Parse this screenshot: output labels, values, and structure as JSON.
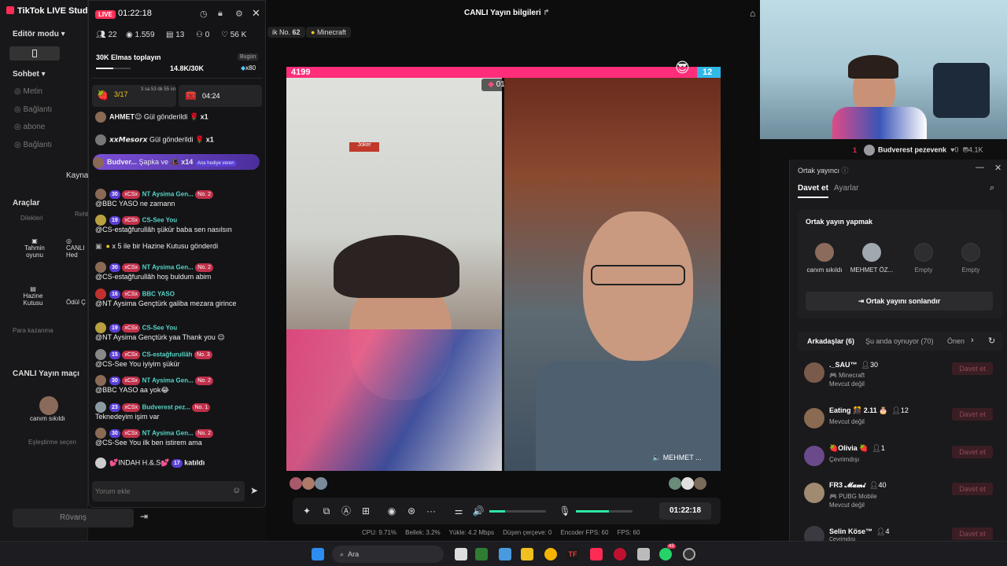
{
  "studio": {
    "title": "TikTok LIVE Studio",
    "editor_mode": "Editör modu",
    "chat_label": "Sohbet",
    "chat_items": [
      "Metin",
      "Bağlantı",
      "abone",
      "Bağlantı"
    ],
    "source": "Kaynak",
    "tools_label": "Araçlar",
    "tool_dilekler": "Dilekleri",
    "tool_rehber": "Rehb",
    "tool_tahmin": "Tahmin oyunu",
    "tool_canli": "CANLI Hed",
    "tool_hazine": "Hazine Kutusu",
    "tool_odul": "Ödül Ç",
    "money_label": "Para kazanma",
    "match_label": "CANLI Yayın maçı",
    "match_guest": "canım sıkıldı",
    "pairing": "Eşleştirme seçen",
    "rematch": "Rövanş"
  },
  "chat": {
    "live_badge": "LIVE",
    "timer": "01:22:18",
    "viewers": "22",
    "views": "1.559",
    "gifts": "13",
    "shares": "0",
    "likes": "56 K",
    "goal_title": "30K Elmas toplayın",
    "goal_tag": "Bugün",
    "goal_progress": "14.8K/30K",
    "goal_progress_pct": 49,
    "goal_mult": "x80",
    "box1_count": "3/17",
    "box1_time": "3 sa 53 dk 55 sn",
    "box2_time": "04:24",
    "gift1_user": "AHMET😉",
    "gift1_text": "Gül gönderildi",
    "gift1_count": "x1",
    "gift2_user": "𝙭𝙭𝙈𝙚𝙨𝙤𝙧𝙭",
    "gift2_text": "Gül gönderildi",
    "gift2_count": "x1",
    "gift3_user": "Budver...",
    "gift3_text": "Şapka ve",
    "gift3_count": "x14",
    "gift3_tag": "Ana hediye veren",
    "messages": [
      {
        "lvl": "30",
        "tag": "xCSx",
        "name": "NT Aysima Gen...",
        "rank": "No. 2",
        "text": "@BBC YASO ne zamann"
      },
      {
        "lvl": "19",
        "tag": "xCSx",
        "name": "CS-See You",
        "rank": "",
        "text": "@CS-estağfurullâh şükür baba sen nasılsın"
      },
      {
        "lvl": "",
        "tag": "",
        "name": "",
        "rank": "",
        "text": "x 5 ile bir Hazine Kutusu gönderdi"
      },
      {
        "lvl": "30",
        "tag": "xCSx",
        "name": "NT Aysima Gen...",
        "rank": "No. 2",
        "text": "@CS-estağfurullâh hoş buldum abim"
      },
      {
        "lvl": "16",
        "tag": "xCSx",
        "name": "BBC YASO",
        "rank": "",
        "text": "@NT Aysima Gençtürk galiba mezara girince"
      },
      {
        "lvl": "19",
        "tag": "xCSx",
        "name": "CS-See You",
        "rank": "",
        "text": "@NT Aysima Gençtürk yaa Thank you 😉"
      },
      {
        "lvl": "15",
        "tag": "xCSx",
        "name": "CS-estağfurullâh",
        "rank": "No. 3",
        "text": "@CS-See You iyiyim şükür"
      },
      {
        "lvl": "30",
        "tag": "xCSx",
        "name": "NT Aysima Gen...",
        "rank": "No. 2",
        "text": "@BBC YASO aa yok😂"
      },
      {
        "lvl": "23",
        "tag": "xCSx",
        "name": "Budverest pez...",
        "rank": "No. 1",
        "text": "Teknedeyim işim var"
      },
      {
        "lvl": "30",
        "tag": "xCSx",
        "name": "NT Aysima Gen...",
        "rank": "No. 2",
        "text": "@CS-See You ilk ben istirem ama"
      }
    ],
    "joined_user": "💕INDAH H.&.S💕",
    "joined_lvl": "17",
    "joined_text": "katıldı",
    "comment_placeholder": "Yorum ekle"
  },
  "center": {
    "title": "CANLI Yayın bilgileri",
    "rank_label": "ik No.",
    "rank_value": "62",
    "game": "Minecraft",
    "score_left": "4199",
    "score_right": "12",
    "battle_timer": "01:01",
    "right_name": "MEHMET ...",
    "time": "01:22:18"
  },
  "status": {
    "cpu": "CPU: 9.71%",
    "mem": "Bellek: 3.2%",
    "upload": "Yükle: 4.2 Mbps",
    "dropped": "Düşen çerçeve: 0",
    "encoder": "Encoder FPS: 60",
    "fps": "FPS: 60"
  },
  "cam": {
    "rank": "1",
    "user": "Budverest pezevenk",
    "hearts": "0",
    "coins": "4.1K"
  },
  "cohost": {
    "title": "Ortak yayıncı",
    "tab_invite": "Davet et",
    "tab_settings": "Ayarlar",
    "section": "Ortak yayın yapmak",
    "guests": [
      "canım sıkıldı",
      "MEHMET ÖZ...",
      "Empty",
      "Empty"
    ],
    "end_button": "Ortak yayını sonlandır",
    "friends_tab": "Arkadaşlar (6)",
    "playing_tab": "Şu anda oynuyor (70)",
    "next_tab": "Önen",
    "friends": [
      {
        "name": "._SAU™",
        "count": "30",
        "sub1": "🎮 Minecraft",
        "sub2": "Mevcut değil",
        "invite": "Davet et"
      },
      {
        "name": "Eating 🎊 2.11 🎂",
        "count": "12",
        "sub1": "",
        "sub2": "Mevcut değil",
        "invite": "Davet et"
      },
      {
        "name": "🍓Olivia 🍓",
        "count": "1",
        "sub1": "",
        "sub2": "Çevrimdışı",
        "invite": "Davet et"
      },
      {
        "name": "FR3 𝓜𝓪𝓶𝓲",
        "count": "40",
        "sub1": "🎮 PUBG Mobile",
        "sub2": "Mevcut değil",
        "invite": "Davet et"
      },
      {
        "name": "Selin Köse™",
        "count": "4",
        "sub1": "",
        "sub2": "Çevrimdışı",
        "invite": "Davet et"
      }
    ]
  },
  "taskbar": {
    "search": "Ara",
    "badge": "43"
  }
}
